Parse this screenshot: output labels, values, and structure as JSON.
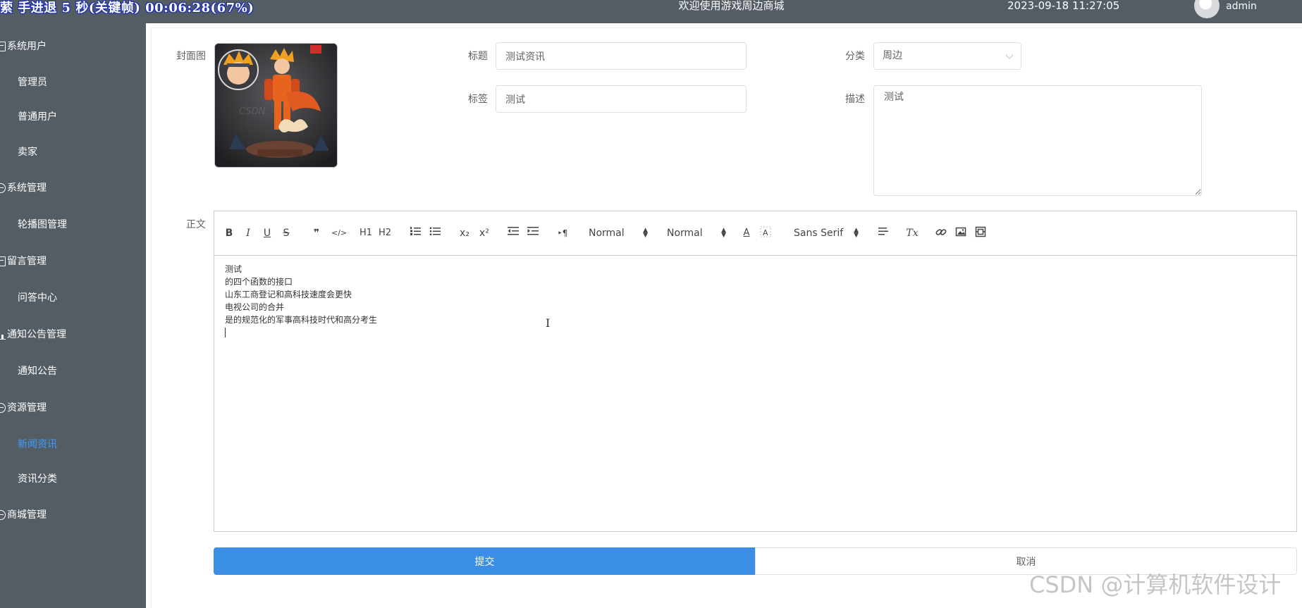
{
  "header": {
    "overlay_text": "萦 手进退 5 秒(关键帧) 00:06:28(67%)",
    "welcome": "欢迎使用游戏周边商城",
    "datetime": "2023-09-18 11:27:05",
    "username": "admin"
  },
  "sidebar": {
    "items": [
      {
        "label": "系统用户",
        "type": "group",
        "icon": "document-icon"
      },
      {
        "label": "管理员",
        "type": "child"
      },
      {
        "label": "普通用户",
        "type": "child"
      },
      {
        "label": "卖家",
        "type": "child"
      },
      {
        "label": "系统管理",
        "type": "group",
        "icon": "circle-icon"
      },
      {
        "label": "轮播图管理",
        "type": "child"
      },
      {
        "label": "留言管理",
        "type": "group",
        "icon": "document-icon"
      },
      {
        "label": "问答中心",
        "type": "child"
      },
      {
        "label": "通知公告管理",
        "type": "group",
        "icon": "bar-chart-icon"
      },
      {
        "label": "通知公告",
        "type": "child"
      },
      {
        "label": "资源管理",
        "type": "group",
        "icon": "circle-icon"
      },
      {
        "label": "新闻资讯",
        "type": "child",
        "active": true
      },
      {
        "label": "资讯分类",
        "type": "child"
      },
      {
        "label": "商城管理",
        "type": "group",
        "icon": "circle-icon"
      }
    ]
  },
  "form": {
    "cover_label": "封面图",
    "title_label": "标题",
    "title_value": "测试资讯",
    "category_label": "分类",
    "category_value": "周边",
    "tags_label": "标签",
    "tags_value": "测试",
    "description_label": "描述",
    "description_value": "测试",
    "body_label": "正文"
  },
  "editor": {
    "toolbar": {
      "bold": "B",
      "italic": "I",
      "underline": "U",
      "strike": "S",
      "blockquote": "❞",
      "code": "</>",
      "h1": "H1",
      "h2": "H2",
      "subscript": "x₂",
      "superscript": "x²",
      "direction": "‣¶",
      "size_picker": "Normal",
      "header_picker": "Normal",
      "color": "A",
      "font_picker": "Sans Serif",
      "clean": "Tx"
    },
    "lines": [
      "测试",
      "的四个函数的接口",
      "山东工商登记和高科技速度会更快",
      "电视公司的合并",
      "是的规范化的军事高科技时代和高分考生"
    ]
  },
  "buttons": {
    "submit": "提交",
    "cancel": "取消"
  },
  "watermark": "CSDN @计算机软件设计",
  "colors": {
    "sidebar_bg": "#545c64",
    "accent": "#409eff",
    "submit_bg": "#3a8ee6"
  }
}
